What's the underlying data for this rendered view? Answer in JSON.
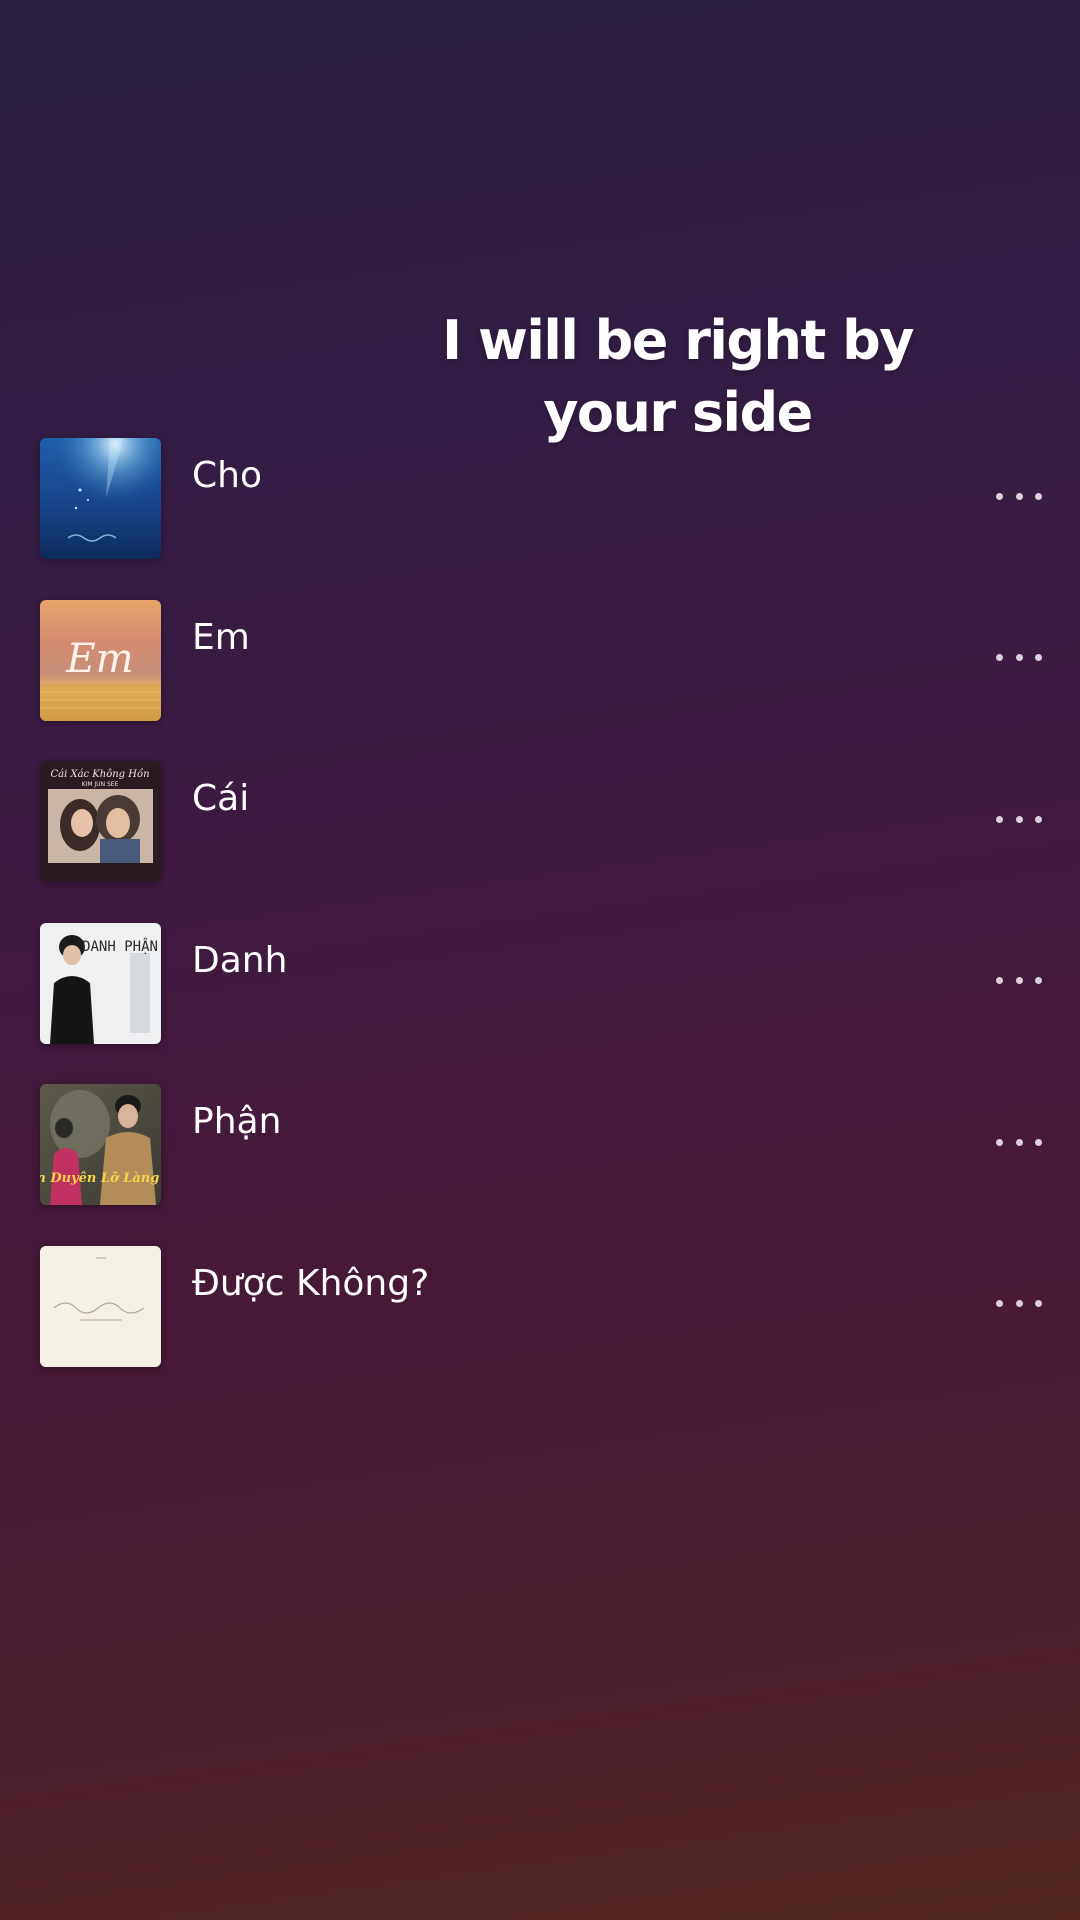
{
  "lyric": {
    "line1": "I will be right by",
    "line2": "your side"
  },
  "tracks": [
    {
      "title": "Cho",
      "art": "blue-underwater-album-art"
    },
    {
      "title": "Em",
      "art": "sunset-em-album-art",
      "art_text": "Em"
    },
    {
      "title": "Cái",
      "art": "couple-album-art",
      "art_text": "Cái Xác Không Hồn",
      "art_subtext": "KIM JUN SEE"
    },
    {
      "title": "Danh",
      "art": "danh-phan-album-art",
      "art_text": "DANH PHẬN"
    },
    {
      "title": "Phận",
      "art": "phan-duyen-album-art",
      "art_text": "Phận Duyên Lỡ Làng"
    },
    {
      "title": "Được Không?",
      "art": "minimal-cream-album-art"
    }
  ],
  "more_icon": "more-horizontal-icon"
}
